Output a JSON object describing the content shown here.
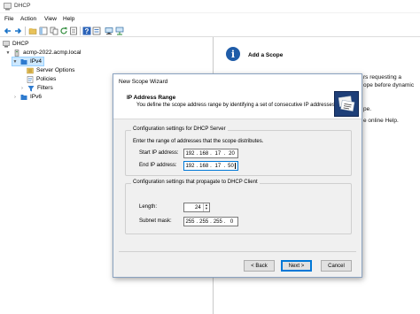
{
  "window": {
    "title": "DHCP"
  },
  "menu": [
    "File",
    "Action",
    "View",
    "Help"
  ],
  "toolbar": {
    "icons": [
      "back-icon",
      "forward-icon",
      "up-folder-icon",
      "show-hide-tree-icon",
      "copy-icon",
      "refresh-icon",
      "export-list-icon",
      "help-icon",
      "properties-icon",
      "computer-icon",
      "network-icon"
    ]
  },
  "tree": {
    "root": "DHCP",
    "server": "acmp-2022.acmp.local",
    "ipv4": "IPv4",
    "server_options": "Server Options",
    "policies": "Policies",
    "filters": "Filters",
    "ipv6": "IPv6"
  },
  "right_pane": {
    "title": "Add a Scope",
    "bg_lines": [
      "rs requesting a",
      "ope before dynamic",
      "pe.",
      "e online Help."
    ]
  },
  "wizard": {
    "title": "New Scope Wizard",
    "heading": "IP Address Range",
    "description": "You define the scope address range by identifying a set of consecutive IP addresses.",
    "dhcp_server_group": {
      "legend": "Configuration settings for DHCP Server",
      "instruction": "Enter the range of addresses that the scope distributes.",
      "start_label": "Start IP address:",
      "start_ip": [
        "192",
        "168",
        "17",
        "20"
      ],
      "end_label": "End IP address:",
      "end_ip": [
        "192",
        "168",
        "17",
        "50"
      ]
    },
    "client_group": {
      "legend": "Configuration settings that propagate to DHCP Client",
      "length_label": "Length:",
      "length_value": "24",
      "mask_label": "Subnet mask:",
      "mask": [
        "255",
        "255",
        "255",
        "0"
      ]
    },
    "buttons": {
      "back": "< Back",
      "next": "Next >",
      "cancel": "Cancel"
    }
  }
}
